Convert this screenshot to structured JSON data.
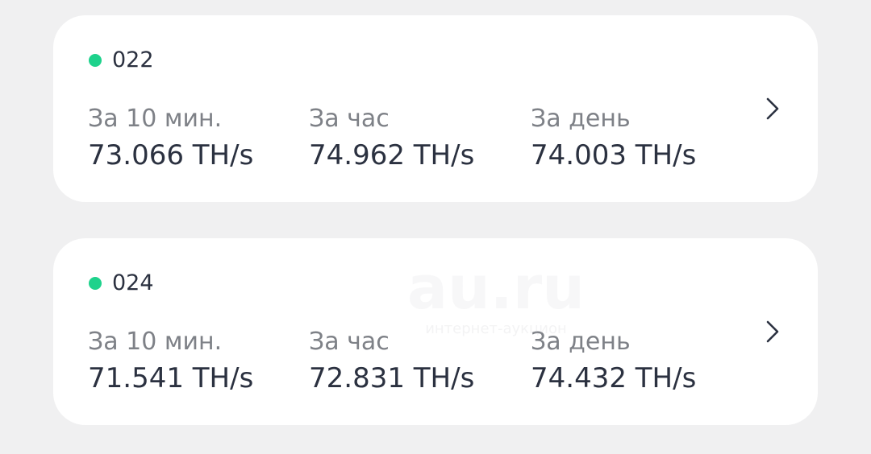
{
  "accent": {
    "online": "#1ed28c"
  },
  "watermark": {
    "logo": "au.ru",
    "tagline": "интернет-аукцион"
  },
  "workers": [
    {
      "name": "022",
      "status": "online",
      "stats": [
        {
          "label": "За 10 мин.",
          "value": "73.066 TH/s"
        },
        {
          "label": "За час",
          "value": "74.962 TH/s"
        },
        {
          "label": "За день",
          "value": "74.003 TH/s"
        }
      ],
      "action_icon": "chevron-right-icon"
    },
    {
      "name": "024",
      "status": "online",
      "stats": [
        {
          "label": "За 10 мин.",
          "value": "71.541 TH/s"
        },
        {
          "label": "За час",
          "value": "72.831 TH/s"
        },
        {
          "label": "За день",
          "value": "74.432 TH/s"
        }
      ],
      "action_icon": "chevron-right-icon"
    }
  ]
}
